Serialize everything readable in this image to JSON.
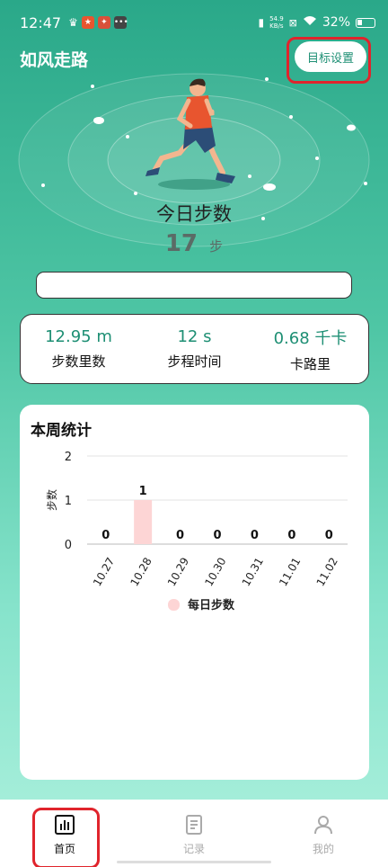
{
  "status_bar": {
    "time": "12:47",
    "net_speed_value": "54.9",
    "net_speed_unit": "KB/s",
    "battery": "32%"
  },
  "header": {
    "title": "如风走路",
    "goal_button": "目标设置"
  },
  "today": {
    "label": "今日步数",
    "steps": "17",
    "unit": "步"
  },
  "stats": [
    {
      "value": "12.95 m",
      "label": "步数里数"
    },
    {
      "value": "12 s",
      "label": "步程时间"
    },
    {
      "value": "0.68 千卡",
      "label": "卡路里"
    }
  ],
  "week_card": {
    "title": "本周统计"
  },
  "chart_data": {
    "type": "bar",
    "categories": [
      "10.27",
      "10.28",
      "10.29",
      "10.30",
      "10.31",
      "11.01",
      "11.02"
    ],
    "series": [
      {
        "name": "每日步数",
        "values": [
          0,
          1,
          0,
          0,
          0,
          0,
          0
        ]
      }
    ],
    "ylabel": "步数",
    "xlabel": "",
    "ylim": [
      0,
      2
    ],
    "yticks": [
      0,
      1,
      2
    ],
    "grid": true,
    "legend": "bottom",
    "bar_color": "#fdd5d5"
  },
  "nav": [
    {
      "label": "首页",
      "icon": "bar-chart-icon",
      "active": true
    },
    {
      "label": "记录",
      "icon": "document-icon",
      "active": false
    },
    {
      "label": "我的",
      "icon": "person-icon",
      "active": false
    }
  ],
  "colors": {
    "brand": "#2aa889",
    "accent_text": "#1e8f74",
    "highlight": "#e0242c"
  }
}
